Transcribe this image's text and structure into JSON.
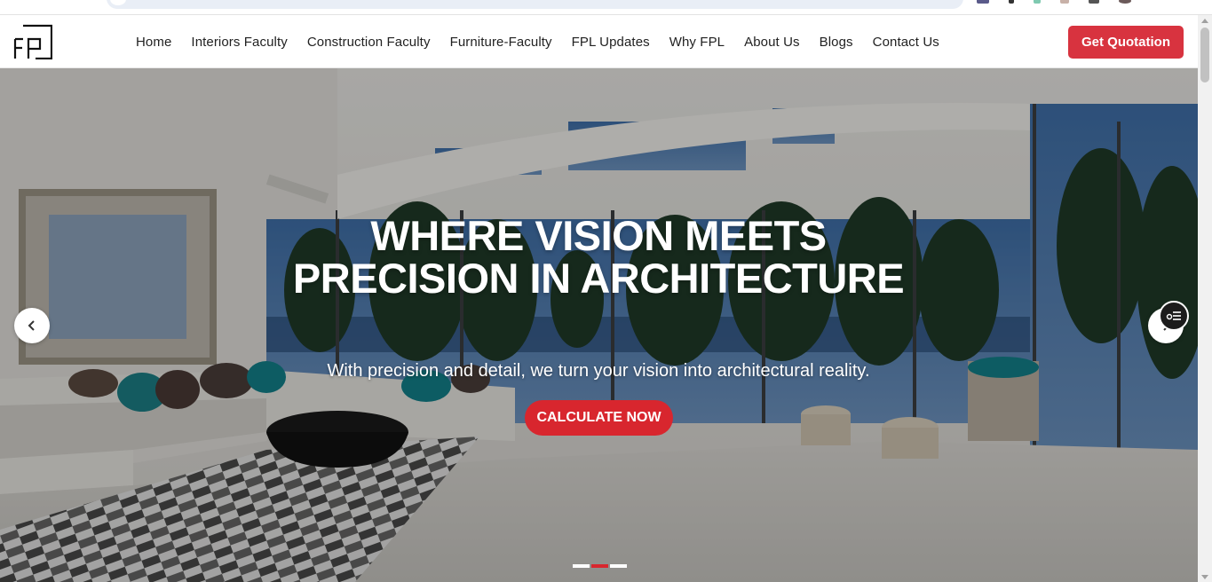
{
  "navbar": {
    "logo_icon": "fpl-logo-icon",
    "items": [
      {
        "label": "Home"
      },
      {
        "label": "Interiors Faculty"
      },
      {
        "label": "Construction Faculty"
      },
      {
        "label": "Furniture-Faculty"
      },
      {
        "label": "FPL Updates"
      },
      {
        "label": "Why FPL"
      },
      {
        "label": "About Us"
      },
      {
        "label": "Blogs"
      },
      {
        "label": "Contact Us"
      }
    ],
    "cta_label": "Get Quotation"
  },
  "hero": {
    "title": "WHERE VISION MEETS PRECISION IN ARCHITECTURE",
    "subtitle": "With precision and detail, we turn your vision into architectural reality.",
    "cta_label": "CALCULATE NOW",
    "prev_icon": "chevron-left-icon",
    "next_icon": "chevron-right-icon",
    "slide_count": 3,
    "active_slide": 2
  },
  "colors": {
    "accent": "#d8333f",
    "button_red": "#d8262e",
    "text_dark": "#222222",
    "white": "#ffffff"
  }
}
